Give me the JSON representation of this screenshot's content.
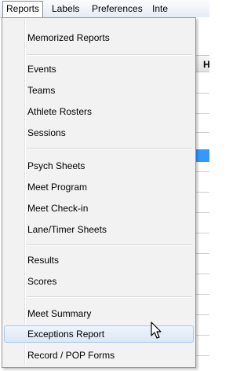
{
  "menubar": {
    "items": [
      "Reports",
      "Labels",
      "Preferences",
      "Inte"
    ]
  },
  "background": {
    "header_text": "H"
  },
  "menu": {
    "groups": [
      [
        "Memorized Reports"
      ],
      [
        "Events",
        "Teams",
        "Athlete Rosters",
        "Sessions"
      ],
      [
        "Psych Sheets",
        "Meet Program",
        "Meet Check-in",
        "Lane/Timer Sheets"
      ],
      [
        "Results",
        "Scores"
      ],
      [
        "Meet Summary",
        "Exceptions Report",
        "Record / POP Forms"
      ]
    ],
    "hovered_item": "Exceptions Report"
  },
  "icons": {
    "cursor": "arrow-cursor-icon"
  }
}
